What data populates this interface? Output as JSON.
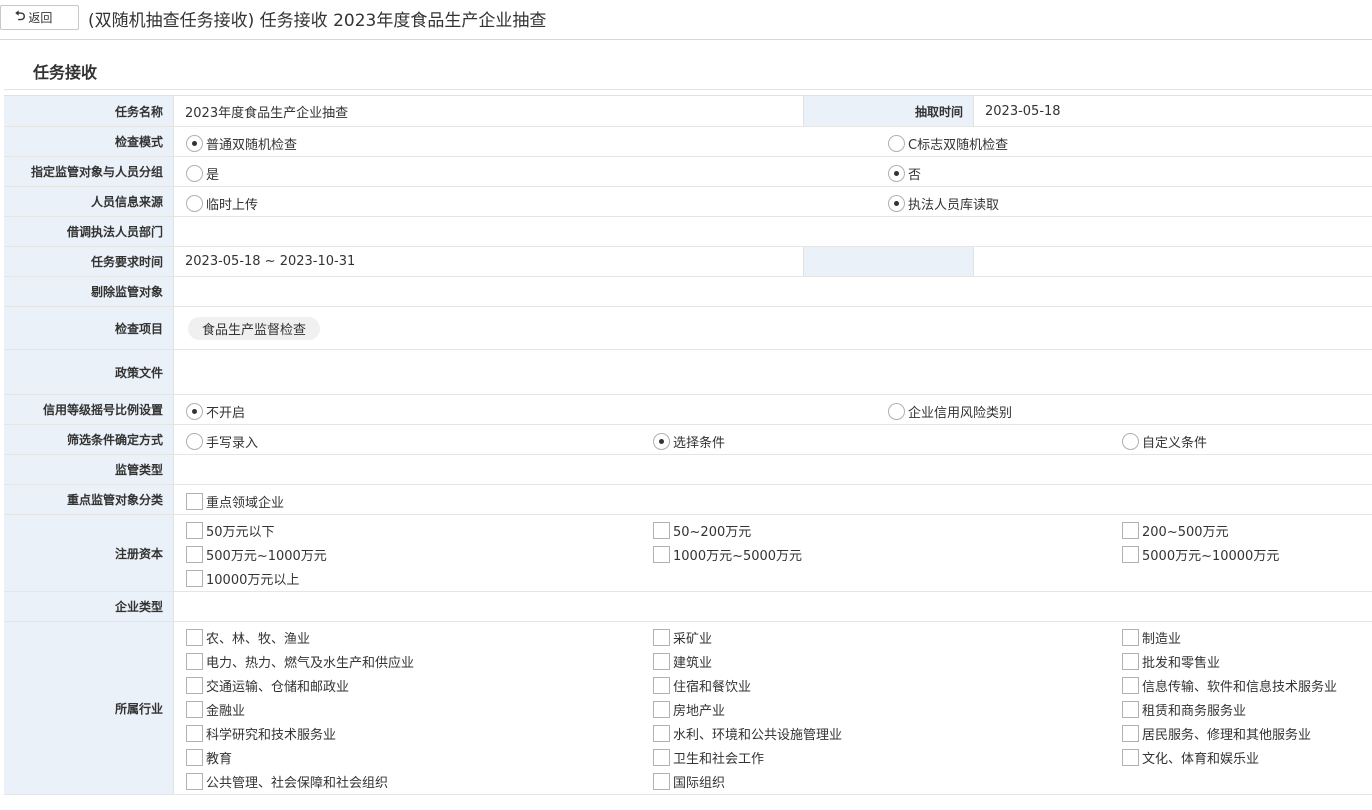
{
  "header": {
    "back_label": "返回",
    "title": "(双随机抽查任务接收) 任务接收 2023年度食品生产企业抽查"
  },
  "section_title": "任务接收",
  "rows": {
    "task_name": {
      "label": "任务名称",
      "value": "2023年度食品生产企业抽查"
    },
    "extract_time": {
      "label": "抽取时间",
      "value": "2023-05-18"
    },
    "check_mode": {
      "label": "检查模式",
      "options": [
        "普通双随机检查",
        "C标志双随机检查"
      ],
      "selected": 0
    },
    "assign_group": {
      "label": "指定监管对象与人员分组",
      "options": [
        "是",
        "否"
      ],
      "selected": 1
    },
    "personnel_source": {
      "label": "人员信息来源",
      "options": [
        "临时上传",
        "执法人员库读取"
      ],
      "selected": 1
    },
    "borrowed_dept": {
      "label": "借调执法人员部门"
    },
    "required_time": {
      "label": "任务要求时间",
      "value": "2023-05-18 ~ 2023-10-31"
    },
    "excluded_objects": {
      "label": "剔除监管对象"
    },
    "inspection_items": {
      "label": "检查项目",
      "tags": [
        "食品生产监督检查"
      ]
    },
    "policy_docs": {
      "label": "政策文件"
    },
    "credit_ratio": {
      "label": "信用等级摇号比例设置",
      "options": [
        "不开启",
        "企业信用风险类别"
      ],
      "selected": 0
    },
    "filter_method": {
      "label": "筛选条件确定方式",
      "options": [
        "手写录入",
        "选择条件",
        "自定义条件"
      ],
      "selected": 1
    },
    "supervision_type": {
      "label": "监管类型"
    },
    "key_category": {
      "label": "重点监管对象分类",
      "options": [
        "重点领域企业"
      ]
    },
    "registered_capital": {
      "label": "注册资本",
      "options": [
        "50万元以下",
        "50~200万元",
        "200~500万元",
        "500万元~1000万元",
        "1000万元~5000万元",
        "5000万元~10000万元",
        "10000万元以上"
      ]
    },
    "enterprise_type": {
      "label": "企业类型"
    },
    "industry": {
      "label": "所属行业",
      "options": [
        "农、林、牧、渔业",
        "采矿业",
        "制造业",
        "电力、热力、燃气及水生产和供应业",
        "建筑业",
        "批发和零售业",
        "交通运输、仓储和邮政业",
        "住宿和餐饮业",
        "信息传输、软件和信息技术服务业",
        "金融业",
        "房地产业",
        "租赁和商务服务业",
        "科学研究和技术服务业",
        "水利、环境和公共设施管理业",
        "居民服务、修理和其他服务业",
        "教育",
        "卫生和社会工作",
        "文化、体育和娱乐业",
        "公共管理、社会保障和社会组织",
        "国际组织"
      ]
    }
  }
}
